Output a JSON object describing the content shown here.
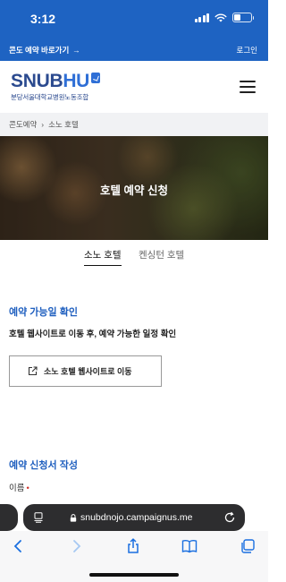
{
  "status_bar": {
    "time": "3:12"
  },
  "top_strip": {
    "quick_link": "콘도 예약 바로가기",
    "quick_arrow": "→",
    "login": "로그인"
  },
  "header": {
    "logo_text_a": "SNUB",
    "logo_text_b": "HU",
    "logo_sub": "분당서울대학교병원노동조합",
    "menu_icon": "hamburger-icon"
  },
  "breadcrumb": {
    "items": [
      "콘도예약",
      "소노 호텔"
    ],
    "separator": "›"
  },
  "hero": {
    "title": "호텔 예약 신청"
  },
  "tabs": [
    {
      "label": "소노 호텔",
      "active": true
    },
    {
      "label": "켄싱턴 호텔",
      "active": false
    }
  ],
  "availability": {
    "title": "예약 가능일 확인",
    "description": "호텔 웹사이트로 이동 후, 예약 가능한 일정 확인",
    "button_label": "소노 호텔 웹사이트로 이동",
    "button_icon": "external-link-icon"
  },
  "application": {
    "title": "예약 신청서 작성",
    "name_label": "이름",
    "required_mark": "•"
  },
  "browser": {
    "url": "snubdnojo.campaignus.me",
    "icons": [
      "reader-icon",
      "lock-icon",
      "reload-icon",
      "back-icon",
      "forward-icon",
      "share-icon",
      "bookmarks-icon",
      "tabs-icon"
    ]
  },
  "colors": {
    "brand_blue": "#1e63c2",
    "section_blue": "#1f5fbf",
    "required_red": "#d0342c"
  }
}
